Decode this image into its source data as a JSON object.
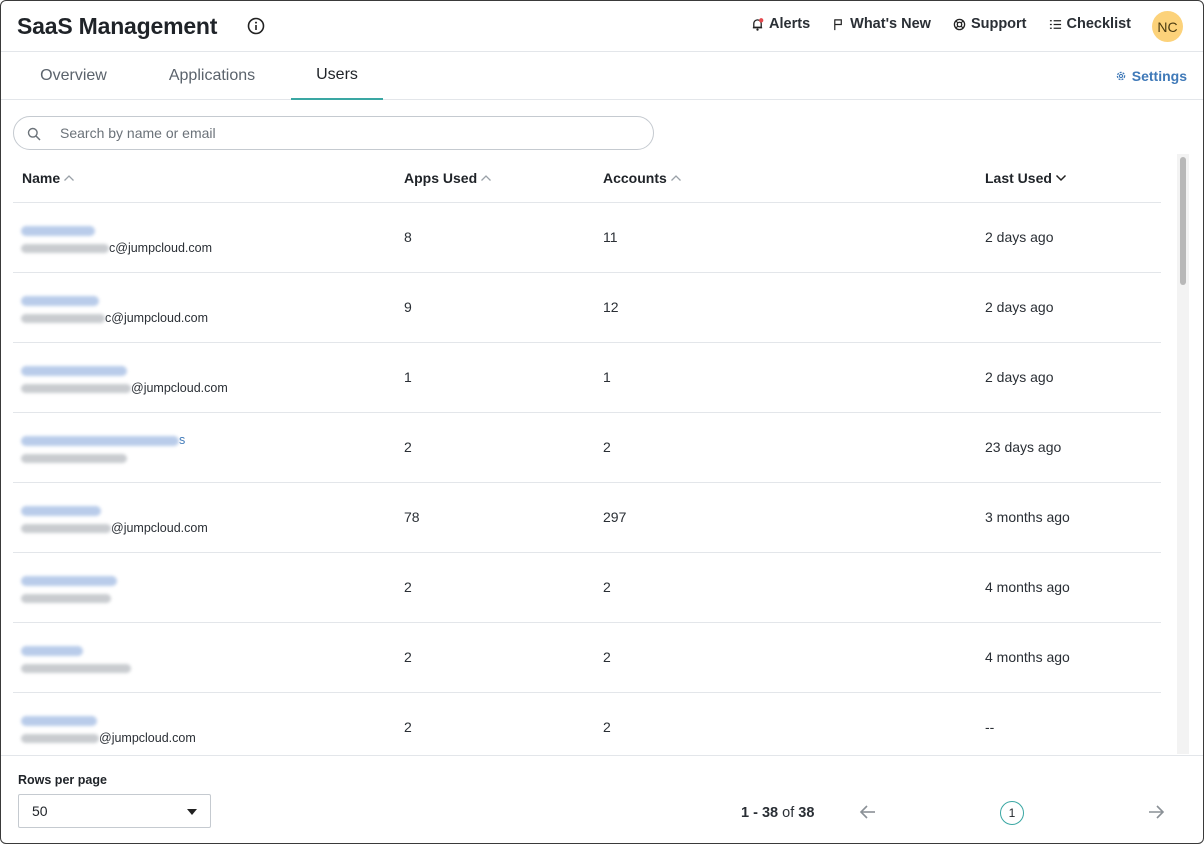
{
  "header": {
    "title": "SaaS Management",
    "nav": [
      {
        "label": "Alerts",
        "icon": "bell-icon"
      },
      {
        "label": "What's New",
        "icon": "flag-icon"
      },
      {
        "label": "Support",
        "icon": "lifebuoy-icon"
      },
      {
        "label": "Checklist",
        "icon": "checklist-icon"
      }
    ],
    "avatar_initials": "NC"
  },
  "tabs": [
    {
      "label": "Overview",
      "active": false
    },
    {
      "label": "Applications",
      "active": false
    },
    {
      "label": "Users",
      "active": true
    }
  ],
  "settings_label": "Settings",
  "search": {
    "placeholder": "Search by name or email",
    "value": ""
  },
  "table": {
    "columns": {
      "name": "Name",
      "apps_used": "Apps Used",
      "accounts": "Accounts",
      "last_used": "Last Used"
    },
    "rows": [
      {
        "name_suffix": "",
        "email_suffix": "c@jumpcloud.com",
        "apps_used": "8",
        "accounts": "11",
        "last_used": "2 days ago"
      },
      {
        "name_suffix": "",
        "email_suffix": "c@jumpcloud.com",
        "apps_used": "9",
        "accounts": "12",
        "last_used": "2 days ago"
      },
      {
        "name_suffix": "",
        "email_suffix": "@jumpcloud.com",
        "apps_used": "1",
        "accounts": "1",
        "last_used": "2 days ago"
      },
      {
        "name_suffix": "s",
        "email_suffix": "",
        "apps_used": "2",
        "accounts": "2",
        "last_used": "23 days ago"
      },
      {
        "name_suffix": "",
        "email_suffix": "@jumpcloud.com",
        "apps_used": "78",
        "accounts": "297",
        "last_used": "3 months ago"
      },
      {
        "name_suffix": "",
        "email_suffix": "",
        "apps_used": "2",
        "accounts": "2",
        "last_used": "4 months ago"
      },
      {
        "name_suffix": "",
        "email_suffix": "",
        "apps_used": "2",
        "accounts": "2",
        "last_used": "4 months ago"
      },
      {
        "name_suffix": "",
        "email_suffix": "@jumpcloud.com",
        "apps_used": "2",
        "accounts": "2",
        "last_used": "--"
      }
    ]
  },
  "footer": {
    "rows_per_page_label": "Rows per page",
    "rows_per_page_value": "50",
    "range": "1 - 38",
    "of_label": "of",
    "total": "38",
    "current_page": "1"
  },
  "colors": {
    "accent": "#3aa7a3",
    "link": "#3f79b8",
    "avatar": "#fcd27a"
  }
}
